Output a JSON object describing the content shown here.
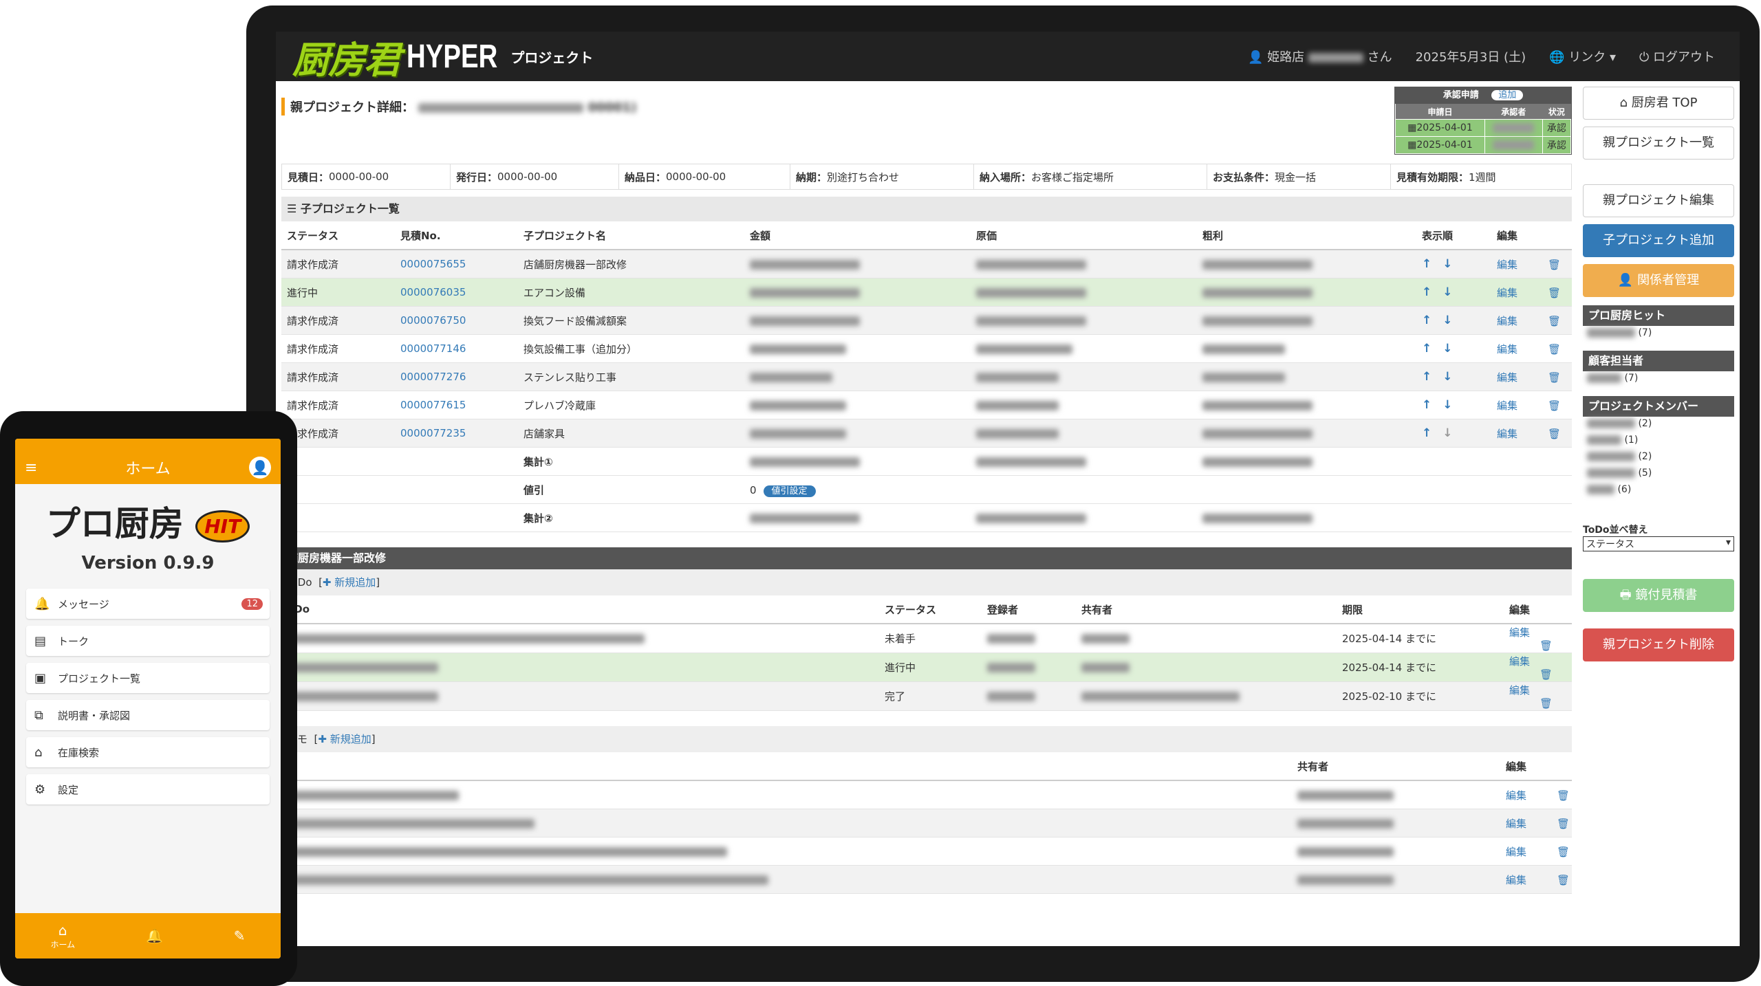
{
  "header": {
    "logo_jp": "厨房君",
    "logo_en": "HYPER",
    "project_label": "プロジェクト",
    "user_store": "姫路店",
    "user_suffix": "さん",
    "date": "2025年5月3日 (土)",
    "link_label": "リンク",
    "logout_label": "ログアウト"
  },
  "page": {
    "title_prefix": "親プロジェクト詳細：",
    "title_suffix": "00001)"
  },
  "approval": {
    "title": "承認申請",
    "add_label": "追加",
    "col_date": "申請日",
    "col_approver": "承認者",
    "col_status": "状況",
    "rows": [
      {
        "date": "2025-04-01",
        "status": "承認"
      },
      {
        "date": "2025-04-01",
        "status": "承認"
      }
    ]
  },
  "info": {
    "estimate_date": "見積日：",
    "estimate_date_val": "0000-00-00",
    "issue_date": "発行日：",
    "issue_date_val": "0000-00-00",
    "delivery_date": "納品日：",
    "delivery_date_val": "0000-00-00",
    "deadline": "納期：",
    "deadline_val": "別途打ち合わせ",
    "place": "納入場所：",
    "place_val": "お客様ご指定場所",
    "payment": "お支払条件：",
    "payment_val": "現金一括",
    "validity": "見積有効期限：",
    "validity_val": "1週間"
  },
  "child_list": {
    "title": "子プロジェクト一覧",
    "cols": [
      "ステータス",
      "見積No.",
      "子プロジェクト名",
      "金額",
      "原価",
      "粗利",
      "表示順",
      "編集"
    ],
    "rows": [
      {
        "status": "請求作成済",
        "no": "0000075655",
        "name": "店舗厨房機器一部改修"
      },
      {
        "status": "進行中",
        "no": "0000076035",
        "name": "エアコン設備"
      },
      {
        "status": "請求作成済",
        "no": "0000076750",
        "name": "換気フード設備減額案"
      },
      {
        "status": "請求作成済",
        "no": "0000077146",
        "name": "換気設備工事（追加分）"
      },
      {
        "status": "請求作成済",
        "no": "0000077276",
        "name": "ステンレス貼り工事"
      },
      {
        "status": "請求作成済",
        "no": "0000077615",
        "name": "プレハブ冷蔵庫"
      },
      {
        "status": "請求作成済",
        "no": "0000077235",
        "name": "店舗家具"
      }
    ],
    "edit_label": "編集",
    "total1": "集計①",
    "discount": "値引",
    "discount_val": "0",
    "discount_btn": "値引設定",
    "total2": "集計②"
  },
  "detail": {
    "bar_title": "舗厨房機器一部改修",
    "todo_label": "ToDo",
    "new_add": "新規追加",
    "todo_cols": [
      "oDo",
      "ステータス",
      "登録者",
      "共有者",
      "期限",
      "編集"
    ],
    "todos": [
      {
        "status": "未着手",
        "due": "2025-04-14 までに"
      },
      {
        "status": "進行中",
        "due": "2025-04-14 までに"
      },
      {
        "status": "完了",
        "due": "2025-02-10 までに"
      }
    ],
    "memo_label": "メモ",
    "memo_cols": [
      "モ",
      "共有者",
      "編集"
    ],
    "memo_count": 4
  },
  "sidebar": {
    "top_btn": "厨房君 TOP",
    "list_btn": "親プロジェクト一覧",
    "edit_btn": "親プロジェクト編集",
    "add_child_btn": "子プロジェクト追加",
    "relations_btn": "関係者管理",
    "hit_head": "プロ厨房ヒット",
    "hit_count": "(7)",
    "client_head": "顧客担当者",
    "client_count": "(7)",
    "members_head": "プロジェクトメンバー",
    "members": [
      "(2)",
      "(1)",
      "(2)",
      "(5)",
      "(6)"
    ],
    "todo_sort": "ToDo並べ替え",
    "todo_sort_val": "ステータス",
    "quote_btn": "鏡付見積書",
    "delete_btn": "親プロジェクト削除"
  },
  "phone": {
    "title": "ホーム",
    "logo": "プロ厨房",
    "logo_badge": "HIT",
    "version": "Version 0.9.9",
    "items": [
      {
        "label": "メッセージ",
        "icon": "bell-icon",
        "badge": "12"
      },
      {
        "label": "トーク",
        "icon": "chat-icon"
      },
      {
        "label": "プロジェクト一覧",
        "icon": "list-icon"
      },
      {
        "label": "説明書・承認図",
        "icon": "document-icon"
      },
      {
        "label": "在庫検索",
        "icon": "warehouse-icon"
      },
      {
        "label": "設定",
        "icon": "gear-icon"
      }
    ],
    "nav_home": "ホーム"
  },
  "colors": {
    "accent_blue": "#337ab7",
    "accent_orange": "#f5a000",
    "header_dark": "#222222",
    "logo_green": "#9ed417"
  }
}
